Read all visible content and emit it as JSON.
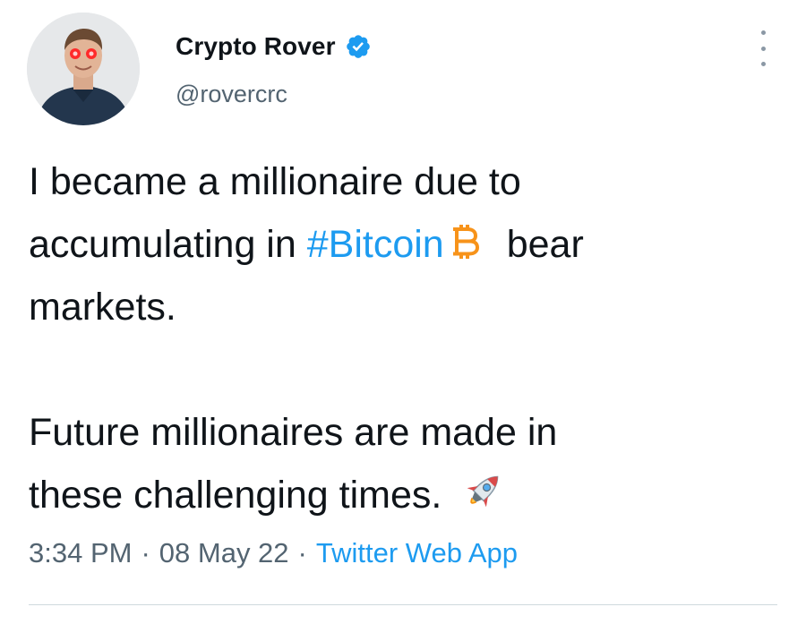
{
  "author": {
    "name": "Crypto Rover",
    "handle": "@rovercrc",
    "verified": true
  },
  "icons": {
    "verified": "verified-badge-icon",
    "more": "more-options-icon",
    "bitcoin": "bitcoin-icon",
    "rocket": "rocket-emoji-icon"
  },
  "tweet": {
    "line1": "I became a millionaire due to",
    "line2_pre": "accumulating in ",
    "hashtag": "#Bitcoin",
    "line2_post": "bear",
    "line3": "markets.",
    "line4": "Future millionaires are made in",
    "line5": "these challenging times."
  },
  "meta": {
    "time": "3:34 PM",
    "date": "08 May 22",
    "separator": "·",
    "source": "Twitter Web App"
  },
  "colors": {
    "link": "#1d9bf0",
    "text": "#0f1419",
    "secondary": "#536471",
    "bitcoin": "#f7931a"
  }
}
